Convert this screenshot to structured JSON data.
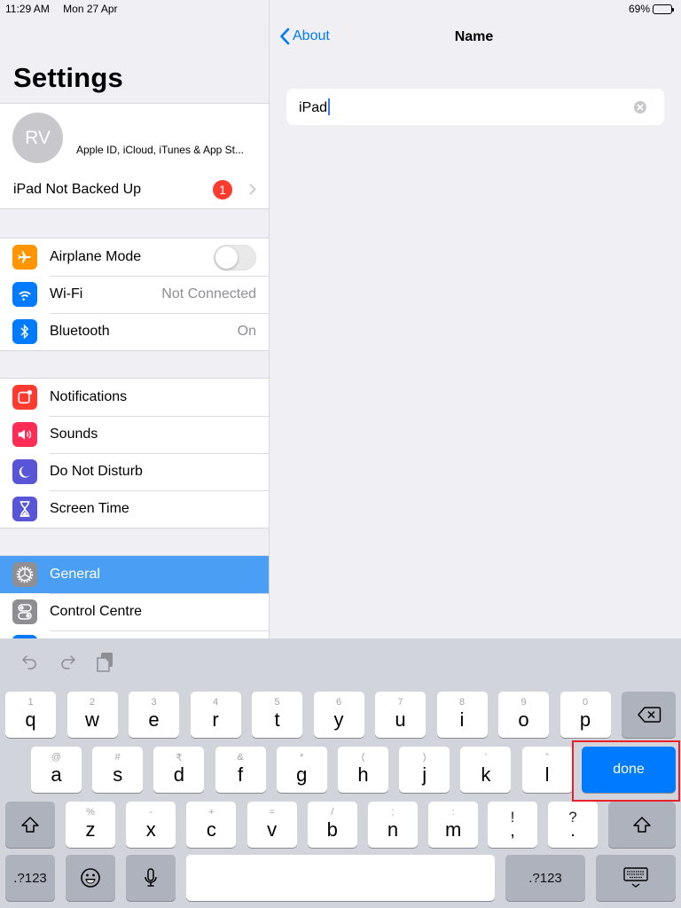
{
  "status_bar": {
    "time": "11:29 AM",
    "date": "Mon 27 Apr",
    "battery_percent_label": "69%",
    "battery_level": 0.69
  },
  "sidebar": {
    "title": "Settings",
    "profile": {
      "initials": "RV",
      "subtitle": "Apple ID, iCloud, iTunes & App St..."
    },
    "backup": {
      "label": "iPad Not Backed Up",
      "badge": "1"
    },
    "groups": [
      {
        "items": [
          {
            "label": "Airplane Mode",
            "icon": "airplane-icon",
            "color": "#ff9500",
            "toggle": false
          },
          {
            "label": "Wi-Fi",
            "icon": "wifi-icon",
            "color": "#007aff",
            "value": "Not Connected"
          },
          {
            "label": "Bluetooth",
            "icon": "bluetooth-icon",
            "color": "#007aff",
            "value": "On"
          }
        ]
      },
      {
        "items": [
          {
            "label": "Notifications",
            "icon": "notifications-icon",
            "color": "#ff3b30"
          },
          {
            "label": "Sounds",
            "icon": "sounds-icon",
            "color": "#ff2d55"
          },
          {
            "label": "Do Not Disturb",
            "icon": "moon-icon",
            "color": "#5856d6"
          },
          {
            "label": "Screen Time",
            "icon": "hourglass-icon",
            "color": "#5856d6"
          }
        ]
      },
      {
        "items": [
          {
            "label": "General",
            "icon": "gear-icon",
            "color": "#8e8e93",
            "selected": true
          },
          {
            "label": "Control Centre",
            "icon": "switches-icon",
            "color": "#8e8e93"
          }
        ]
      }
    ],
    "selected_color": "#4a9ff5"
  },
  "detail": {
    "back_label": "About",
    "title": "Name",
    "name_field_value": "iPad"
  },
  "keyboard": {
    "toolbar": [
      "undo-icon",
      "redo-icon",
      "paste-icon"
    ],
    "row1": [
      {
        "main": "q",
        "alt": "1"
      },
      {
        "main": "w",
        "alt": "2"
      },
      {
        "main": "e",
        "alt": "3"
      },
      {
        "main": "r",
        "alt": "4"
      },
      {
        "main": "t",
        "alt": "5"
      },
      {
        "main": "y",
        "alt": "6"
      },
      {
        "main": "u",
        "alt": "7"
      },
      {
        "main": "i",
        "alt": "8"
      },
      {
        "main": "o",
        "alt": "9"
      },
      {
        "main": "p",
        "alt": "0"
      }
    ],
    "row2": [
      {
        "main": "a",
        "alt": "@"
      },
      {
        "main": "s",
        "alt": "#"
      },
      {
        "main": "d",
        "alt": "₹"
      },
      {
        "main": "f",
        "alt": "&"
      },
      {
        "main": "g",
        "alt": "*"
      },
      {
        "main": "h",
        "alt": "("
      },
      {
        "main": "j",
        "alt": ")"
      },
      {
        "main": "k",
        "alt": "’"
      },
      {
        "main": "l",
        "alt": "”"
      }
    ],
    "row3": [
      {
        "main": "z",
        "alt": "%"
      },
      {
        "main": "x",
        "alt": "-"
      },
      {
        "main": "c",
        "alt": "+"
      },
      {
        "main": "v",
        "alt": "="
      },
      {
        "main": "b",
        "alt": "/"
      },
      {
        "main": "n",
        "alt": ";"
      },
      {
        "main": "m",
        "alt": ":"
      }
    ],
    "punct": [
      {
        "main": ",",
        "alt": "!"
      },
      {
        "main": ".",
        "alt": "?"
      }
    ],
    "done_label": "done",
    "numbers_label": ".?123",
    "accent_color": "#007aff"
  }
}
